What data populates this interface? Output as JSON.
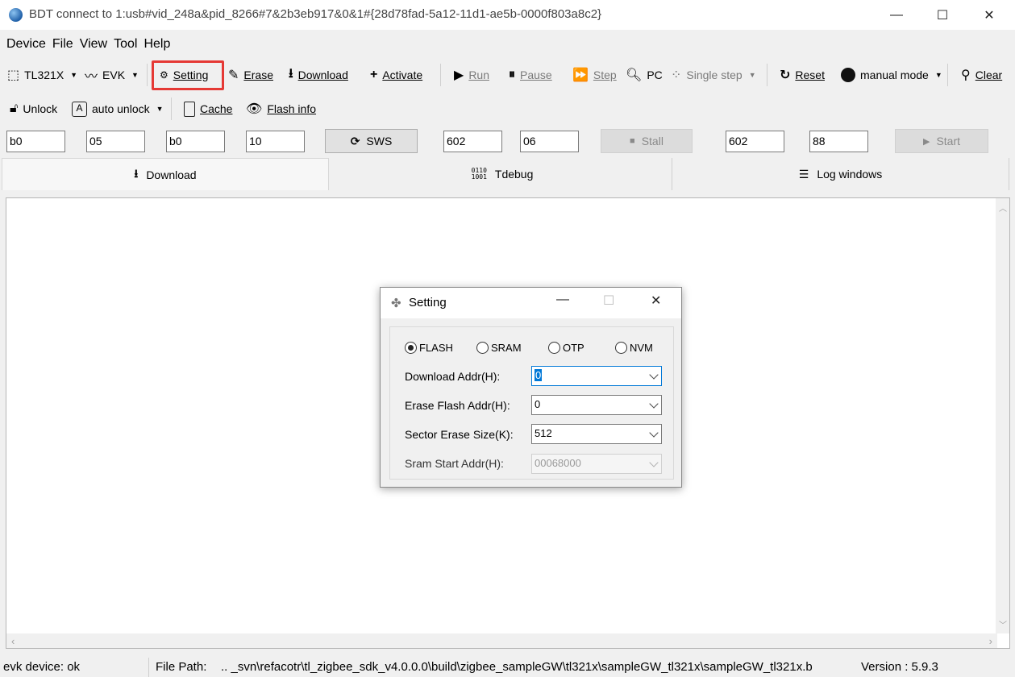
{
  "window": {
    "title": "BDT connect to 1:usb#vid_248a&pid_8266#7&2b3eb917&0&1#{28d78fad-5a12-11d1-ae5b-0000f803a8c2}",
    "minimize": "—",
    "maximize": "☐",
    "close": "✕"
  },
  "menu": [
    "Device",
    "File",
    "View",
    "Tool",
    "Help"
  ],
  "toolbar1": {
    "chip": "TL321X",
    "evk": "EVK",
    "setting": "Setting",
    "erase": "Erase",
    "download": "Download",
    "activate": "Activate",
    "run": "Run",
    "pause": "Pause",
    "step": "Step",
    "pc": "PC",
    "single_step": "Single step",
    "reset": "Reset",
    "manual_mode": "manual mode",
    "clear": "Clear"
  },
  "toolbar2": {
    "unlock": "Unlock",
    "auto_unlock": "auto unlock",
    "cache": "Cache",
    "flash_info": "Flash info"
  },
  "fields": {
    "f1": "b0",
    "f2": "05",
    "f3": "b0",
    "f4": "10",
    "sws": "SWS",
    "f5": "602",
    "f6": "06",
    "stall": "Stall",
    "f7": "602",
    "f8": "88",
    "start": "Start"
  },
  "tabs": [
    "Download",
    "Tdebug",
    "Log windows"
  ],
  "status": {
    "device": "evk device: ok",
    "file_path_label": "File Path:",
    "file_path": "..  _svn\\refacotr\\tl_zigbee_sdk_v4.0.0.0\\build\\zigbee_sampleGW\\tl321x\\sampleGW_tl321x\\sampleGW_tl321x.b",
    "version": "Version : 5.9.3"
  },
  "dialog": {
    "title": "Setting",
    "radios": [
      "FLASH",
      "SRAM",
      "OTP",
      "NVM"
    ],
    "selected_radio": "FLASH",
    "download_addr_label": "Download  Addr(H):",
    "download_addr": "0",
    "erase_flash_label": "Erase Flash Addr(H):",
    "erase_flash": "0",
    "sector_erase_label": "Sector Erase Size(K):",
    "sector_erase": "512",
    "sram_start_label": "Sram Start Addr(H):",
    "sram_start": "00068000"
  }
}
